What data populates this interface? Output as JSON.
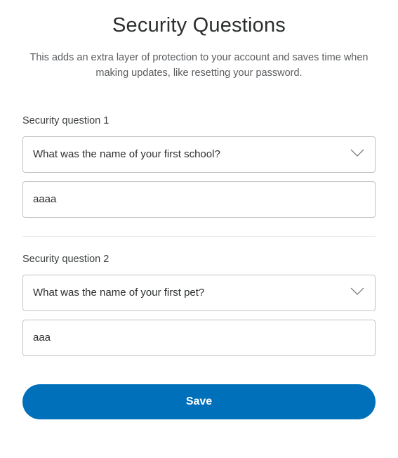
{
  "title": "Security Questions",
  "subtitle": "This adds an extra layer of protection to your account and saves time when making updates, like resetting your password.",
  "questions": [
    {
      "label": "Security question 1",
      "selected": "What was the name of your first school?",
      "answer": "aaaa"
    },
    {
      "label": "Security question 2",
      "selected": "What was the name of your first pet?",
      "answer": "aaa"
    }
  ],
  "save_label": "Save",
  "colors": {
    "primary": "#0070ba"
  }
}
